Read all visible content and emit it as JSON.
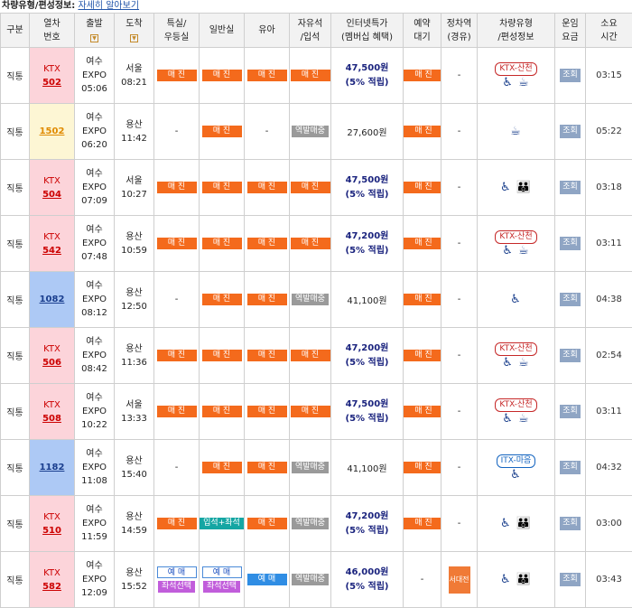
{
  "header": {
    "title": "차량유형/편성정보:",
    "link": "자세히 알아보기"
  },
  "columns": {
    "type": [
      "구분"
    ],
    "train": [
      "열차",
      "번호"
    ],
    "dep": [
      "출발"
    ],
    "arr": [
      "도착"
    ],
    "special": [
      "특실/",
      "우등실"
    ],
    "general": [
      "일반실"
    ],
    "infant": [
      "유아"
    ],
    "free": [
      "자유석",
      "/입석"
    ],
    "internet": [
      "인터넷특가",
      "(멤버십 혜택)"
    ],
    "reserve": [
      "예약",
      "대기"
    ],
    "stop": [
      "정차역",
      "(경유)"
    ],
    "vehicle": [
      "차량유형",
      "/편성정보"
    ],
    "fare": [
      "운임",
      "요금"
    ],
    "duration": [
      "소요",
      "시간"
    ]
  },
  "sort_icon": "sort-down-icon",
  "rows": [
    {
      "kind": "직통",
      "cls": "ktx",
      "ktx": "KTX",
      "num": "502",
      "dep_station": [
        "여수",
        "EXPO"
      ],
      "dep_time": "05:06",
      "arr_station": "서울",
      "arr_time": "08:21",
      "special": "매 진",
      "general": "매 진",
      "infant": "매 진",
      "free": "매 진",
      "price": "47,500원",
      "points": "(5% 적립)",
      "reserve": "매 진",
      "stop": "-",
      "vehicle_badge": "KTX-산천",
      "vehicle_icons": "♿ ☕",
      "fare": "조회",
      "duration": "03:15"
    },
    {
      "kind": "직통",
      "cls": "mu",
      "ktx": "",
      "num": "1502",
      "dep_station": [
        "여수",
        "EXPO"
      ],
      "dep_time": "06:20",
      "arr_station": "용산",
      "arr_time": "11:42",
      "special": "-",
      "general": "매 진",
      "infant": "-",
      "free": "역발매중",
      "price": "27,600원",
      "points": "",
      "reserve": "매 진",
      "stop": "-",
      "vehicle_badge": "",
      "vehicle_icons": "☕",
      "fare": "조회",
      "duration": "05:22"
    },
    {
      "kind": "직통",
      "cls": "ktx",
      "ktx": "KTX",
      "num": "504",
      "dep_station": [
        "여수",
        "EXPO"
      ],
      "dep_time": "07:09",
      "arr_station": "서울",
      "arr_time": "10:27",
      "special": "매 진",
      "general": "매 진",
      "infant": "매 진",
      "free": "매 진",
      "price": "47,500원",
      "points": "(5% 적립)",
      "reserve": "매 진",
      "stop": "-",
      "vehicle_badge": "",
      "vehicle_icons": "♿ 👪",
      "fare": "조회",
      "duration": "03:18"
    },
    {
      "kind": "직통",
      "cls": "ktx",
      "ktx": "KTX",
      "num": "542",
      "dep_station": [
        "여수",
        "EXPO"
      ],
      "dep_time": "07:48",
      "arr_station": "용산",
      "arr_time": "10:59",
      "special": "매 진",
      "general": "매 진",
      "infant": "매 진",
      "free": "매 진",
      "price": "47,200원",
      "points": "(5% 적립)",
      "reserve": "매 진",
      "stop": "-",
      "vehicle_badge": "KTX-산천",
      "vehicle_icons": "♿ ☕",
      "fare": "조회",
      "duration": "03:11"
    },
    {
      "kind": "직통",
      "cls": "itx",
      "ktx": "",
      "num": "1082",
      "dep_station": [
        "여수",
        "EXPO"
      ],
      "dep_time": "08:12",
      "arr_station": "용산",
      "arr_time": "12:50",
      "special": "-",
      "general": "매 진",
      "infant": "매 진",
      "free": "역발매중",
      "price": "41,100원",
      "points": "",
      "reserve": "매 진",
      "stop": "-",
      "vehicle_badge": "",
      "vehicle_icons": "♿",
      "fare": "조회",
      "duration": "04:38"
    },
    {
      "kind": "직통",
      "cls": "ktx",
      "ktx": "KTX",
      "num": "506",
      "dep_station": [
        "여수",
        "EXPO"
      ],
      "dep_time": "08:42",
      "arr_station": "용산",
      "arr_time": "11:36",
      "special": "매 진",
      "general": "매 진",
      "infant": "매 진",
      "free": "매 진",
      "price": "47,200원",
      "points": "(5% 적립)",
      "reserve": "매 진",
      "stop": "-",
      "vehicle_badge": "KTX-산천",
      "vehicle_icons": "♿ ☕",
      "fare": "조회",
      "duration": "02:54"
    },
    {
      "kind": "직통",
      "cls": "ktx",
      "ktx": "KTX",
      "num": "508",
      "dep_station": [
        "여수",
        "EXPO"
      ],
      "dep_time": "10:22",
      "arr_station": "서울",
      "arr_time": "13:33",
      "special": "매 진",
      "general": "매 진",
      "infant": "매 진",
      "free": "매 진",
      "price": "47,500원",
      "points": "(5% 적립)",
      "reserve": "매 진",
      "stop": "-",
      "vehicle_badge": "KTX-산천",
      "vehicle_icons": "♿ ☕",
      "fare": "조회",
      "duration": "03:11"
    },
    {
      "kind": "직통",
      "cls": "itx",
      "ktx": "",
      "num": "1182",
      "dep_station": [
        "여수",
        "EXPO"
      ],
      "dep_time": "11:08",
      "arr_station": "용산",
      "arr_time": "15:40",
      "special": "-",
      "general": "매 진",
      "infant": "매 진",
      "free": "역발매중",
      "price": "41,100원",
      "points": "",
      "reserve": "매 진",
      "stop": "-",
      "vehicle_badge": "ITX-마음",
      "vehicle_icons": "♿",
      "fare": "조회",
      "duration": "04:32"
    },
    {
      "kind": "직통",
      "cls": "ktx",
      "ktx": "KTX",
      "num": "510",
      "dep_station": [
        "여수",
        "EXPO"
      ],
      "dep_time": "11:59",
      "arr_station": "용산",
      "arr_time": "14:59",
      "special": "매 진",
      "general": "입석+좌석",
      "infant": "매 진",
      "free": "역발매중",
      "price": "47,200원",
      "points": "(5% 적립)",
      "reserve": "매 진",
      "stop": "-",
      "vehicle_badge": "",
      "vehicle_icons": "♿ 👪",
      "fare": "조회",
      "duration": "03:00"
    },
    {
      "kind": "직통",
      "cls": "ktx",
      "ktx": "KTX",
      "num": "582",
      "dep_station": [
        "여수",
        "EXPO"
      ],
      "dep_time": "12:09",
      "arr_station": "용산",
      "arr_time": "15:52",
      "special": "예 매",
      "special_sub": "좌석선택",
      "general": "예 매",
      "general_sub": "좌석선택",
      "infant": "예 매",
      "free": "역발매중",
      "price": "46,000원",
      "points": "(5% 적립)",
      "reserve": "-",
      "stop": "서대전",
      "vehicle_badge": "",
      "vehicle_icons": "♿ 👪",
      "fare": "조회",
      "duration": "03:43"
    }
  ]
}
